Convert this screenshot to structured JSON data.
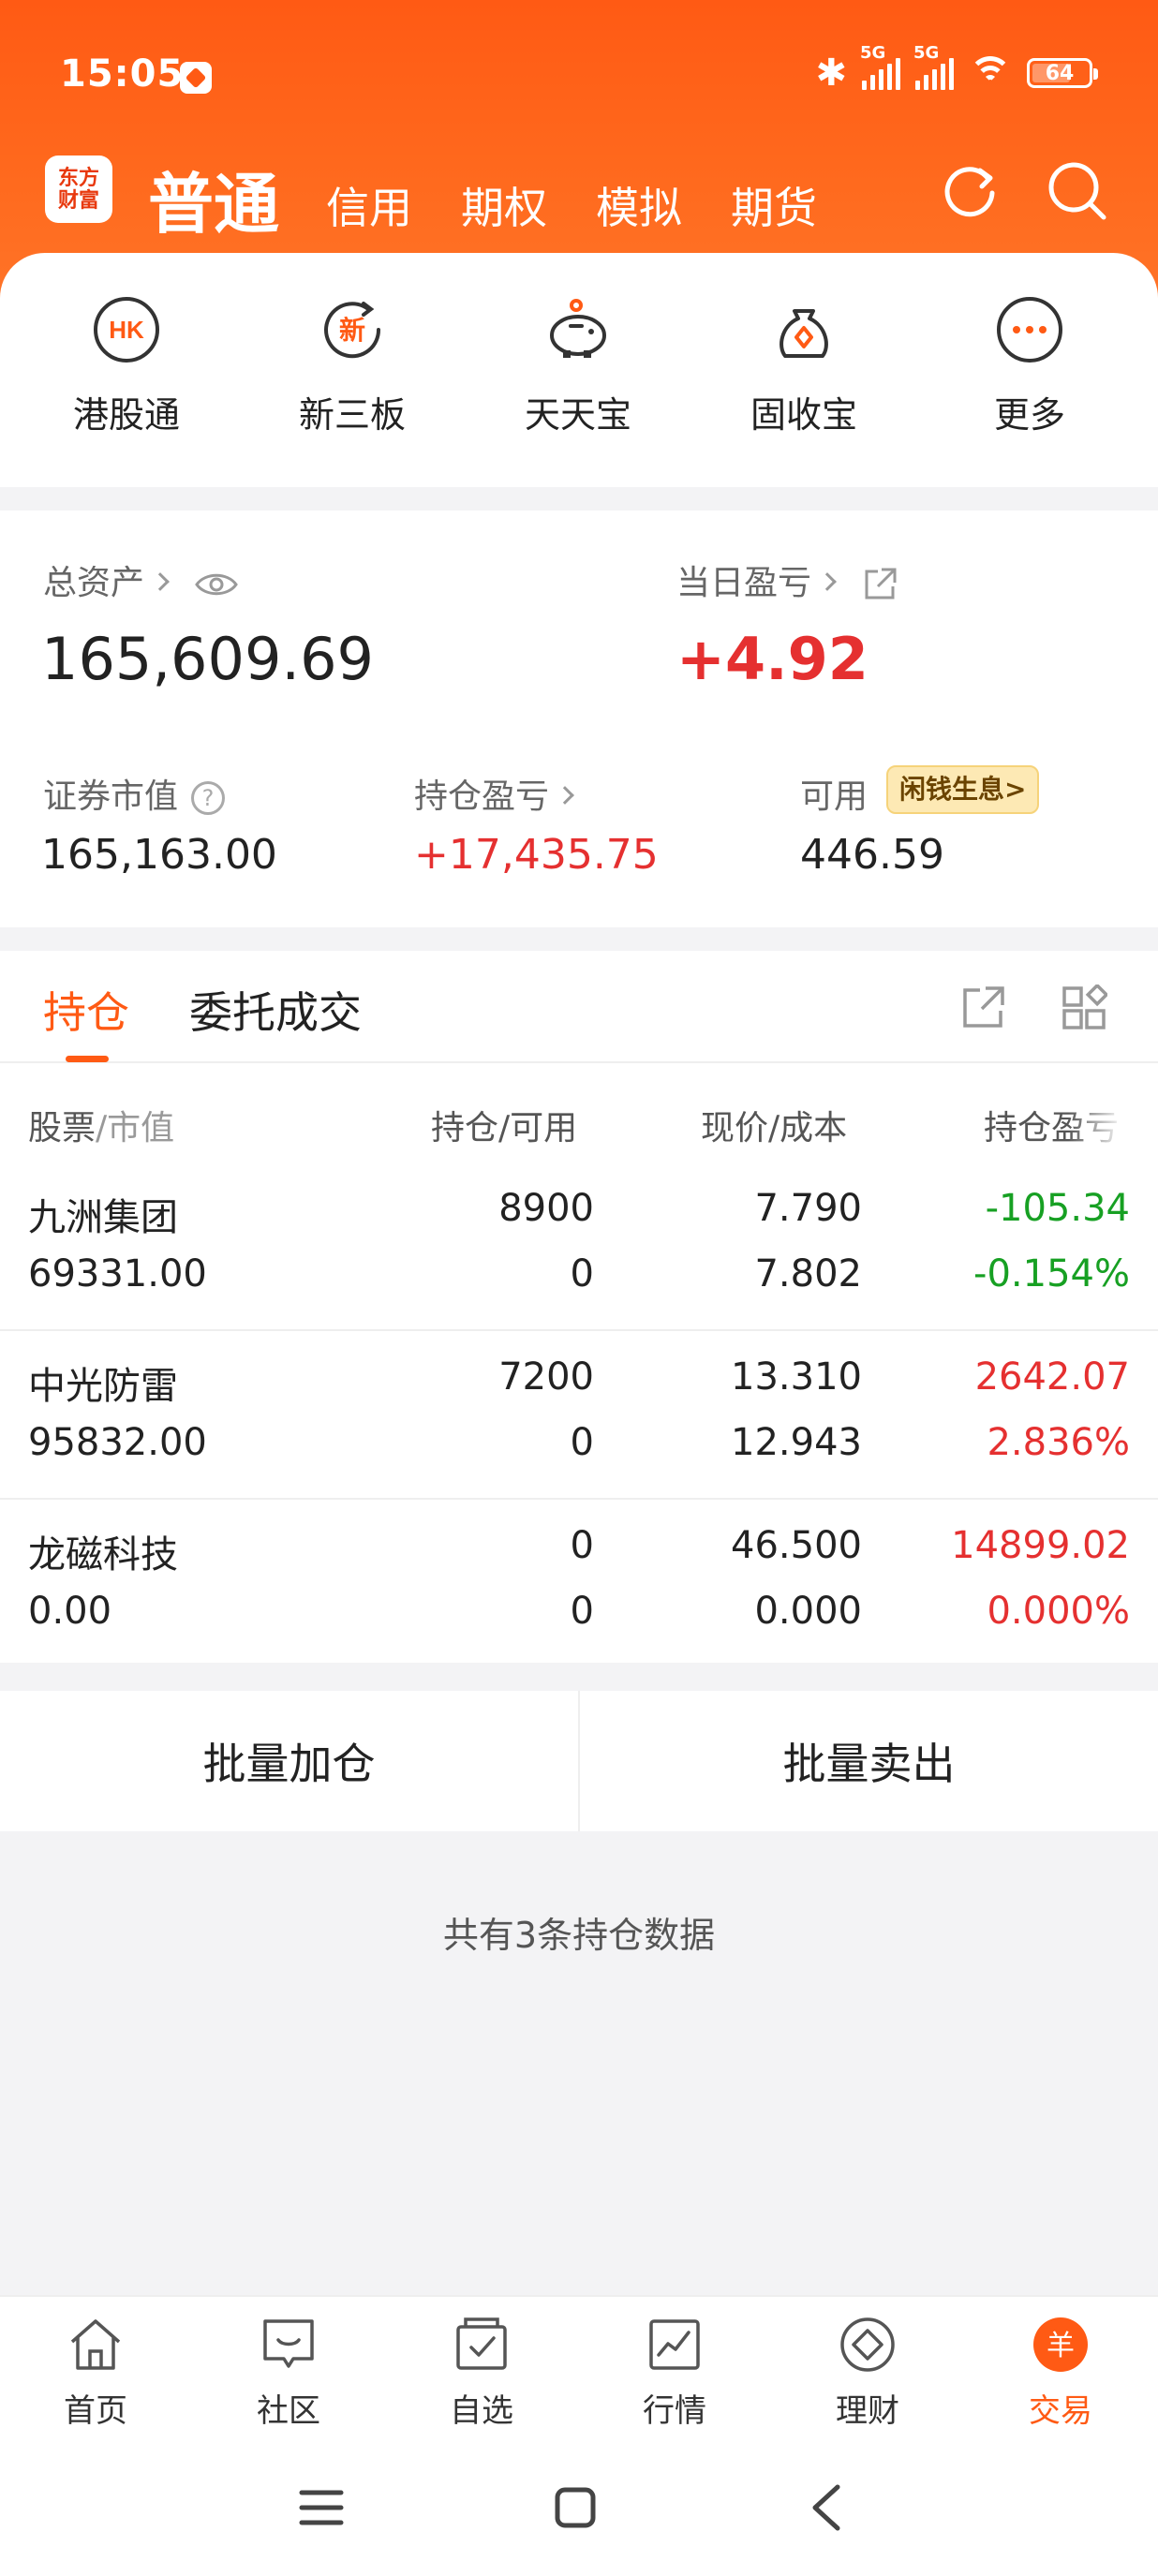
{
  "status_bar": {
    "time": "15:05",
    "network_1": "5G",
    "network_2": "5G",
    "battery": "64"
  },
  "header": {
    "logo_line1": "东方",
    "logo_line2": "财富",
    "active_tab": "普通",
    "tabs": [
      "信用",
      "期权",
      "模拟",
      "期货"
    ],
    "icons": [
      "refresh-icon",
      "search-icon"
    ]
  },
  "shortcuts": [
    {
      "label": "港股通",
      "icon": "hk-icon",
      "icon_text": "HK"
    },
    {
      "label": "新三板",
      "icon": "new-board-icon",
      "icon_text": "新"
    },
    {
      "label": "天天宝",
      "icon": "piggy-bank-icon"
    },
    {
      "label": "固收宝",
      "icon": "money-bag-icon"
    },
    {
      "label": "更多",
      "icon": "more-icon"
    }
  ],
  "assets": {
    "total_label": "总资产",
    "total_value": "165,609.69",
    "daily_pl_label": "当日盈亏",
    "daily_pl_value": "+4.92",
    "market_value_label": "证券市值",
    "market_value": "165,163.00",
    "holding_pl_label": "持仓盈亏",
    "holding_pl_value": "+17,435.75",
    "available_label": "可用",
    "available_value": "446.59",
    "promo_badge": "闲钱生息>"
  },
  "holdings": {
    "tabs": [
      "持仓",
      "委托成交"
    ],
    "headers": {
      "stock": "股票",
      "market_value": "/市值",
      "position": "持仓/可用",
      "price": "现价/成本",
      "pl": "持仓盈亏"
    },
    "rows": [
      {
        "name": "九洲集团",
        "market_value": "69331.00",
        "position": "8900",
        "available": "0",
        "price": "7.790",
        "cost": "7.802",
        "pl": "-105.34",
        "pl_pct": "-0.154%",
        "trend": "down"
      },
      {
        "name": "中光防雷",
        "market_value": "95832.00",
        "position": "7200",
        "available": "0",
        "price": "13.310",
        "cost": "12.943",
        "pl": "2642.07",
        "pl_pct": "2.836%",
        "trend": "up"
      },
      {
        "name": "龙磁科技",
        "market_value": "0.00",
        "position": "0",
        "available": "0",
        "price": "46.500",
        "cost": "0.000",
        "pl": "14899.02",
        "pl_pct": "0.000%",
        "trend": "up"
      }
    ]
  },
  "batch": {
    "add": "批量加仓",
    "sell": "批量卖出"
  },
  "summary": "共有3条持仓数据",
  "bottom_nav": [
    {
      "label": "首页",
      "icon": "home-icon"
    },
    {
      "label": "社区",
      "icon": "community-icon"
    },
    {
      "label": "自选",
      "icon": "watchlist-icon"
    },
    {
      "label": "行情",
      "icon": "market-icon"
    },
    {
      "label": "理财",
      "icon": "wealth-icon"
    },
    {
      "label": "交易",
      "icon": "trade-icon",
      "icon_text": "羊",
      "active": true
    }
  ],
  "colors": {
    "brand": "#ff5a14",
    "up": "#e53030",
    "down": "#17a023"
  }
}
